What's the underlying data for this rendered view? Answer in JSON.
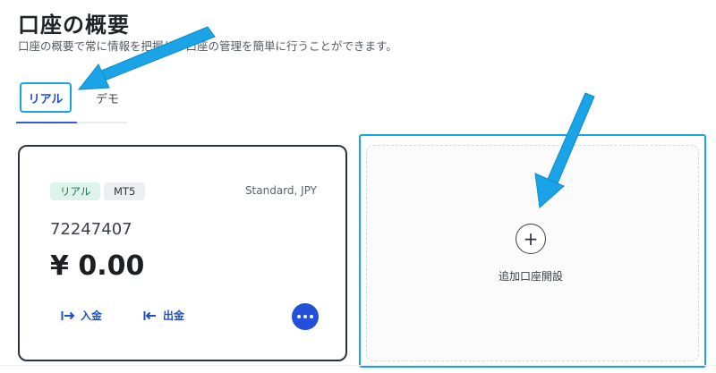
{
  "header": {
    "title": "口座の概要",
    "subtitle": "口座の概要で常に情報を把握し、口座の管理を簡単に行うことができます。"
  },
  "tabs": [
    {
      "label": "リアル",
      "active": true
    },
    {
      "label": "デモ",
      "active": false
    }
  ],
  "account_card": {
    "badges": [
      "リアル",
      "MT5"
    ],
    "account_type": "Standard, JPY",
    "account_number": "72247407",
    "balance": "¥ 0.00",
    "deposit_label": "入金",
    "withdraw_label": "出金"
  },
  "add_account": {
    "label": "追加口座開設"
  },
  "colors": {
    "primary_blue": "#2250d8",
    "highlight_cyan": "#1aa3e6",
    "badge_green_bg": "#def4ea",
    "card_border": "#2b3340"
  },
  "icons": {
    "deposit": "arrow-to-right-icon",
    "withdraw": "arrow-from-left-icon",
    "more": "more-dots-icon",
    "add": "plus-icon"
  }
}
